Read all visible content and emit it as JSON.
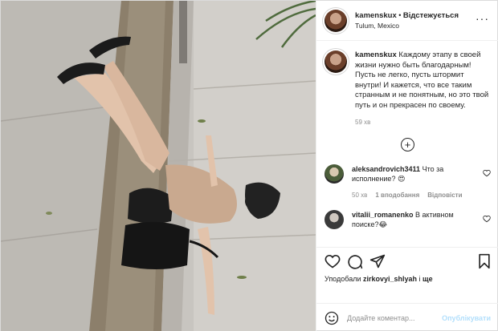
{
  "header": {
    "username": "kamenskux",
    "separator": " • ",
    "follow_label": "Відстежується",
    "location": "Tulum, Mexico",
    "more_icon": "more-horizontal-icon"
  },
  "caption": {
    "username": "kamenskux",
    "text": "Каждому этапу в своей жизни нужно быть благодарным! Пусть не легко, пусть штормит внутри! И кажется, что все таким странным и не понятным, но это твой путь и он прекрасен по своему.",
    "time": "59 хв"
  },
  "load_more_icon": "plus-circle-icon",
  "comments": [
    {
      "username": "aleksandrovich3411",
      "text": "Что за исполнение? 😍",
      "time": "50 хв",
      "likes": "1 вподобання",
      "reply": "Відповісти"
    },
    {
      "username": "vitalii_romanenko",
      "text": "В активном поиске?😂",
      "time": "",
      "likes": "",
      "reply": ""
    }
  ],
  "actions": {
    "like_icon": "heart-icon",
    "comment_icon": "comment-icon",
    "share_icon": "send-icon",
    "save_icon": "bookmark-icon",
    "liked_prefix": "Уподобали ",
    "liked_user": "zirkovyi_shlyah",
    "liked_suffix": " і ",
    "liked_others": "ще"
  },
  "add_comment": {
    "emoji_icon": "emoji-smile-icon",
    "placeholder": "Додайте коментар...",
    "publish_label": "Опублікувати"
  },
  "colors": {
    "text": "#262626",
    "muted": "#8e8e8e",
    "border": "#efefef",
    "publish_disabled": "#b2dffc"
  }
}
